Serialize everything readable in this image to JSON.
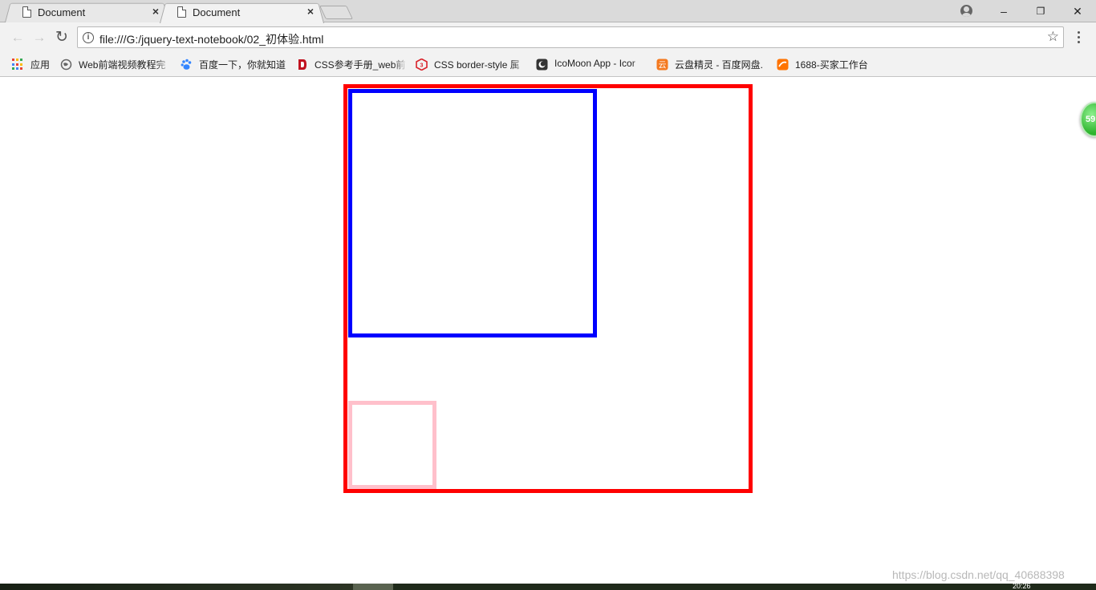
{
  "tabs": [
    {
      "title": "Document",
      "active": false
    },
    {
      "title": "Document",
      "active": true
    }
  ],
  "window_controls": {
    "minimize": "–",
    "restore": "❐",
    "close": "✕"
  },
  "toolbar": {
    "back": "←",
    "forward": "→",
    "reload": "↻",
    "url": "file:///G:/jquery-text-notebook/02_初体验.html",
    "info_glyph": "i",
    "star": "☆"
  },
  "bookmarks": [
    {
      "label": "应用",
      "icon": "apps-grid-icon"
    },
    {
      "label": "Web前端视频教程完",
      "icon": "globe-icon"
    },
    {
      "label": "百度一下，你就知道",
      "icon": "baidu-paw-icon"
    },
    {
      "label": "CSS参考手册_web前",
      "icon": "css-logo-icon"
    },
    {
      "label": "CSS border-style 属",
      "icon": "w3-logo-icon"
    },
    {
      "label": "IcoMoon App - Icor",
      "icon": "icomoon-icon"
    },
    {
      "label": "云盘精灵 - 百度网盘.",
      "icon": "cloud-disk-icon"
    },
    {
      "label": "1688-买家工作台",
      "icon": "1688-icon"
    }
  ],
  "page": {
    "boxes": [
      {
        "name": "outer-box",
        "border_color": "#ff0000"
      },
      {
        "name": "blue-box",
        "border_color": "#0000ff"
      },
      {
        "name": "pink-box",
        "border_color": "#ffc0cb"
      }
    ],
    "side_badge": "59"
  },
  "taskbar": {
    "clock": "20:26"
  },
  "watermark": "https://blog.csdn.net/qq_40688398"
}
